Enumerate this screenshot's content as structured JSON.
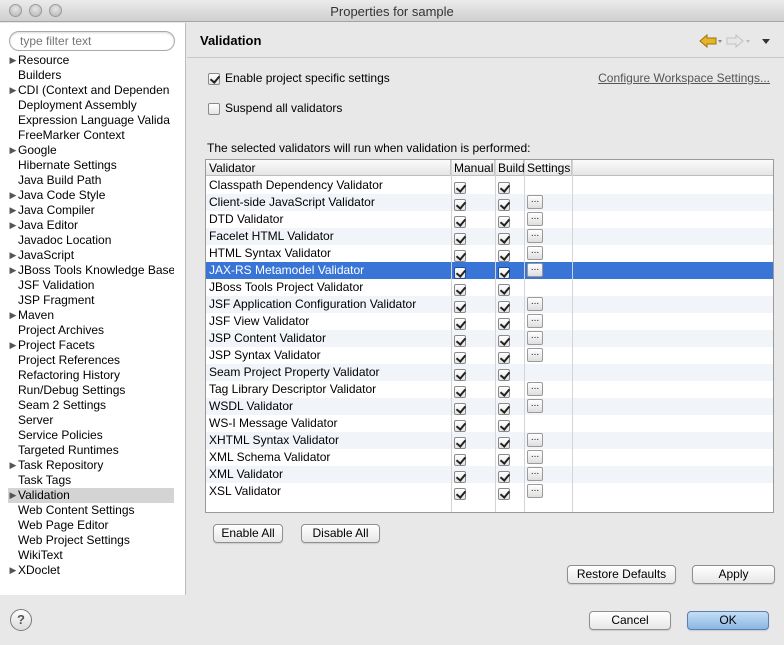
{
  "window": {
    "title": "Properties for sample"
  },
  "sidebar": {
    "filter_placeholder": "type filter text",
    "items": [
      {
        "label": "Resource",
        "expandable": true
      },
      {
        "label": "Builders",
        "expandable": false
      },
      {
        "label": "CDI (Context and Dependen",
        "expandable": true
      },
      {
        "label": "Deployment Assembly",
        "expandable": false
      },
      {
        "label": "Expression Language Valida",
        "expandable": false
      },
      {
        "label": "FreeMarker Context",
        "expandable": false
      },
      {
        "label": "Google",
        "expandable": true
      },
      {
        "label": "Hibernate Settings",
        "expandable": false
      },
      {
        "label": "Java Build Path",
        "expandable": false
      },
      {
        "label": "Java Code Style",
        "expandable": true
      },
      {
        "label": "Java Compiler",
        "expandable": true
      },
      {
        "label": "Java Editor",
        "expandable": true
      },
      {
        "label": "Javadoc Location",
        "expandable": false
      },
      {
        "label": "JavaScript",
        "expandable": true
      },
      {
        "label": "JBoss Tools Knowledge Base",
        "expandable": true
      },
      {
        "label": "JSF Validation",
        "expandable": false
      },
      {
        "label": "JSP Fragment",
        "expandable": false
      },
      {
        "label": "Maven",
        "expandable": true
      },
      {
        "label": "Project Archives",
        "expandable": false
      },
      {
        "label": "Project Facets",
        "expandable": true
      },
      {
        "label": "Project References",
        "expandable": false
      },
      {
        "label": "Refactoring History",
        "expandable": false
      },
      {
        "label": "Run/Debug Settings",
        "expandable": false
      },
      {
        "label": "Seam 2 Settings",
        "expandable": false
      },
      {
        "label": "Server",
        "expandable": false
      },
      {
        "label": "Service Policies",
        "expandable": false
      },
      {
        "label": "Targeted Runtimes",
        "expandable": false
      },
      {
        "label": "Task Repository",
        "expandable": true
      },
      {
        "label": "Task Tags",
        "expandable": false
      },
      {
        "label": "Validation",
        "expandable": true,
        "selected": true
      },
      {
        "label": "Web Content Settings",
        "expandable": false
      },
      {
        "label": "Web Page Editor",
        "expandable": false
      },
      {
        "label": "Web Project Settings",
        "expandable": false
      },
      {
        "label": "WikiText",
        "expandable": false
      },
      {
        "label": "XDoclet",
        "expandable": true
      }
    ]
  },
  "main": {
    "title": "Validation",
    "enable_specific": {
      "label": "Enable project specific settings",
      "checked": true
    },
    "configure_link": "Configure Workspace Settings...",
    "suspend_all": {
      "label": "Suspend all validators",
      "checked": false
    },
    "caption": "The selected validators will run when validation is performed:",
    "columns": [
      "Validator",
      "Manual",
      "Build",
      "Settings"
    ],
    "rows": [
      {
        "name": "Classpath Dependency Validator",
        "manual": true,
        "build": true,
        "settings": false
      },
      {
        "name": "Client-side JavaScript Validator",
        "manual": true,
        "build": true,
        "settings": true
      },
      {
        "name": "DTD Validator",
        "manual": true,
        "build": true,
        "settings": true
      },
      {
        "name": "Facelet HTML Validator",
        "manual": true,
        "build": true,
        "settings": true
      },
      {
        "name": "HTML Syntax Validator",
        "manual": true,
        "build": true,
        "settings": true
      },
      {
        "name": "JAX-RS Metamodel Validator",
        "manual": true,
        "build": true,
        "settings": true,
        "selected": true
      },
      {
        "name": "JBoss Tools Project Validator",
        "manual": true,
        "build": true,
        "settings": false
      },
      {
        "name": "JSF Application Configuration Validator",
        "manual": true,
        "build": true,
        "settings": true
      },
      {
        "name": "JSF View Validator",
        "manual": true,
        "build": true,
        "settings": true
      },
      {
        "name": "JSP Content Validator",
        "manual": true,
        "build": true,
        "settings": true
      },
      {
        "name": "JSP Syntax Validator",
        "manual": true,
        "build": true,
        "settings": true
      },
      {
        "name": "Seam Project Property Validator",
        "manual": true,
        "build": true,
        "settings": false
      },
      {
        "name": "Tag Library Descriptor Validator",
        "manual": true,
        "build": true,
        "settings": true
      },
      {
        "name": "WSDL Validator",
        "manual": true,
        "build": true,
        "settings": true
      },
      {
        "name": "WS-I Message Validator",
        "manual": true,
        "build": true,
        "settings": false
      },
      {
        "name": "XHTML Syntax Validator",
        "manual": true,
        "build": true,
        "settings": true
      },
      {
        "name": "XML Schema Validator",
        "manual": true,
        "build": true,
        "settings": true
      },
      {
        "name": "XML Validator",
        "manual": true,
        "build": true,
        "settings": true
      },
      {
        "name": "XSL Validator",
        "manual": true,
        "build": true,
        "settings": true
      }
    ],
    "settings_button_label": "...",
    "enable_all": "Enable All",
    "disable_all": "Disable All",
    "restore_defaults": "Restore Defaults",
    "apply": "Apply"
  },
  "footer": {
    "help_label": "?",
    "cancel": "Cancel",
    "ok": "OK"
  },
  "icons": {
    "back": "back-arrow-icon",
    "forward": "forward-arrow-icon",
    "menu": "dropdown-menu-icon"
  },
  "colors": {
    "selection": "#3875d7",
    "back_arrow": "#e8b325"
  }
}
